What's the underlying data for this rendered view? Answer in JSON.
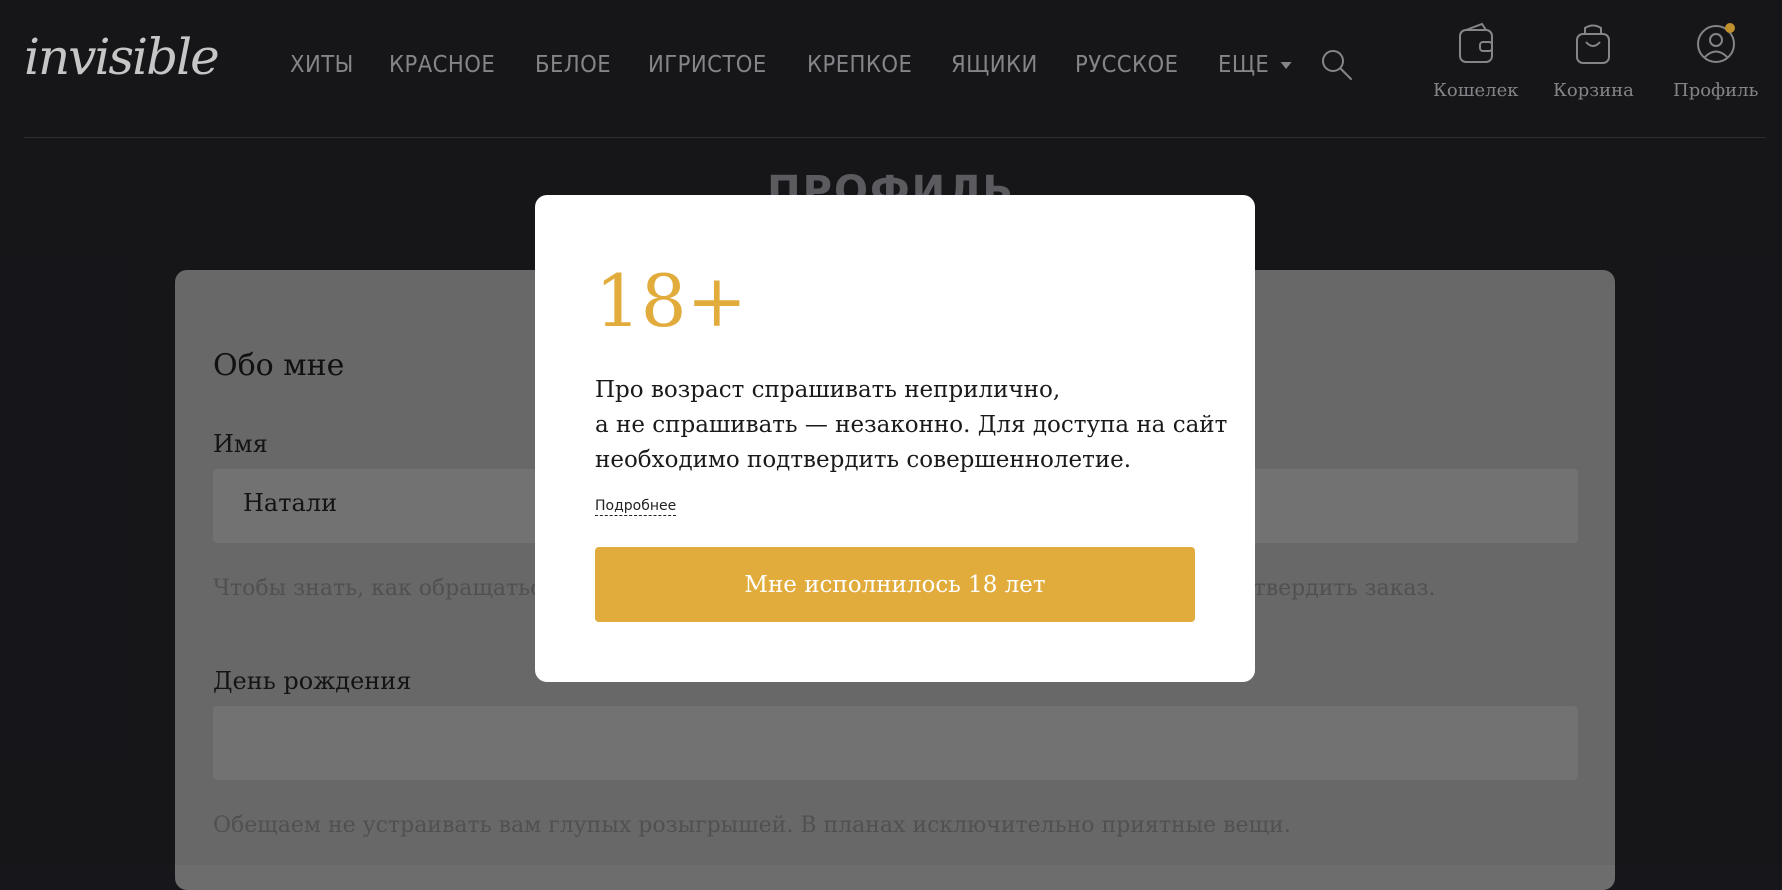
{
  "header": {
    "logo": "invisible",
    "nav": [
      "ХИТЫ",
      "КРАСНОЕ",
      "БЕЛОЕ",
      "ИГРИСТОЕ",
      "КРЕПКОЕ",
      "ЯЩИКИ",
      "РУССКОЕ"
    ],
    "nav_more": "ЕЩЕ",
    "wallet_label": "Кошелек",
    "cart_label": "Корзина",
    "profile_label": "Профиль",
    "profile_dot_color": "#c8962e"
  },
  "page": {
    "title": "ПРОФИЛЬ",
    "section_title": "Обо мне",
    "name_label": "Имя",
    "name_value": "Натали",
    "name_hint_left": "Чтобы знать, как обращаться",
    "name_hint_right": "дтвердить заказ.",
    "birthday_label": "День рождения",
    "birthday_hint": "Обещаем не устраивать вам глупых розыгрышей. В планах исключительно приятные вещи."
  },
  "modal": {
    "age": "18+",
    "text_lines": [
      "Про возраст спрашивать неприлично,",
      "а не спрашивать — незаконно. Для доступа на сайт",
      "необходимо подтвердить совершеннолетие."
    ],
    "more_link": "Подробнее",
    "confirm_button": "Мне исполнилось 18 лет",
    "accent_color": "#e1ac3c"
  }
}
